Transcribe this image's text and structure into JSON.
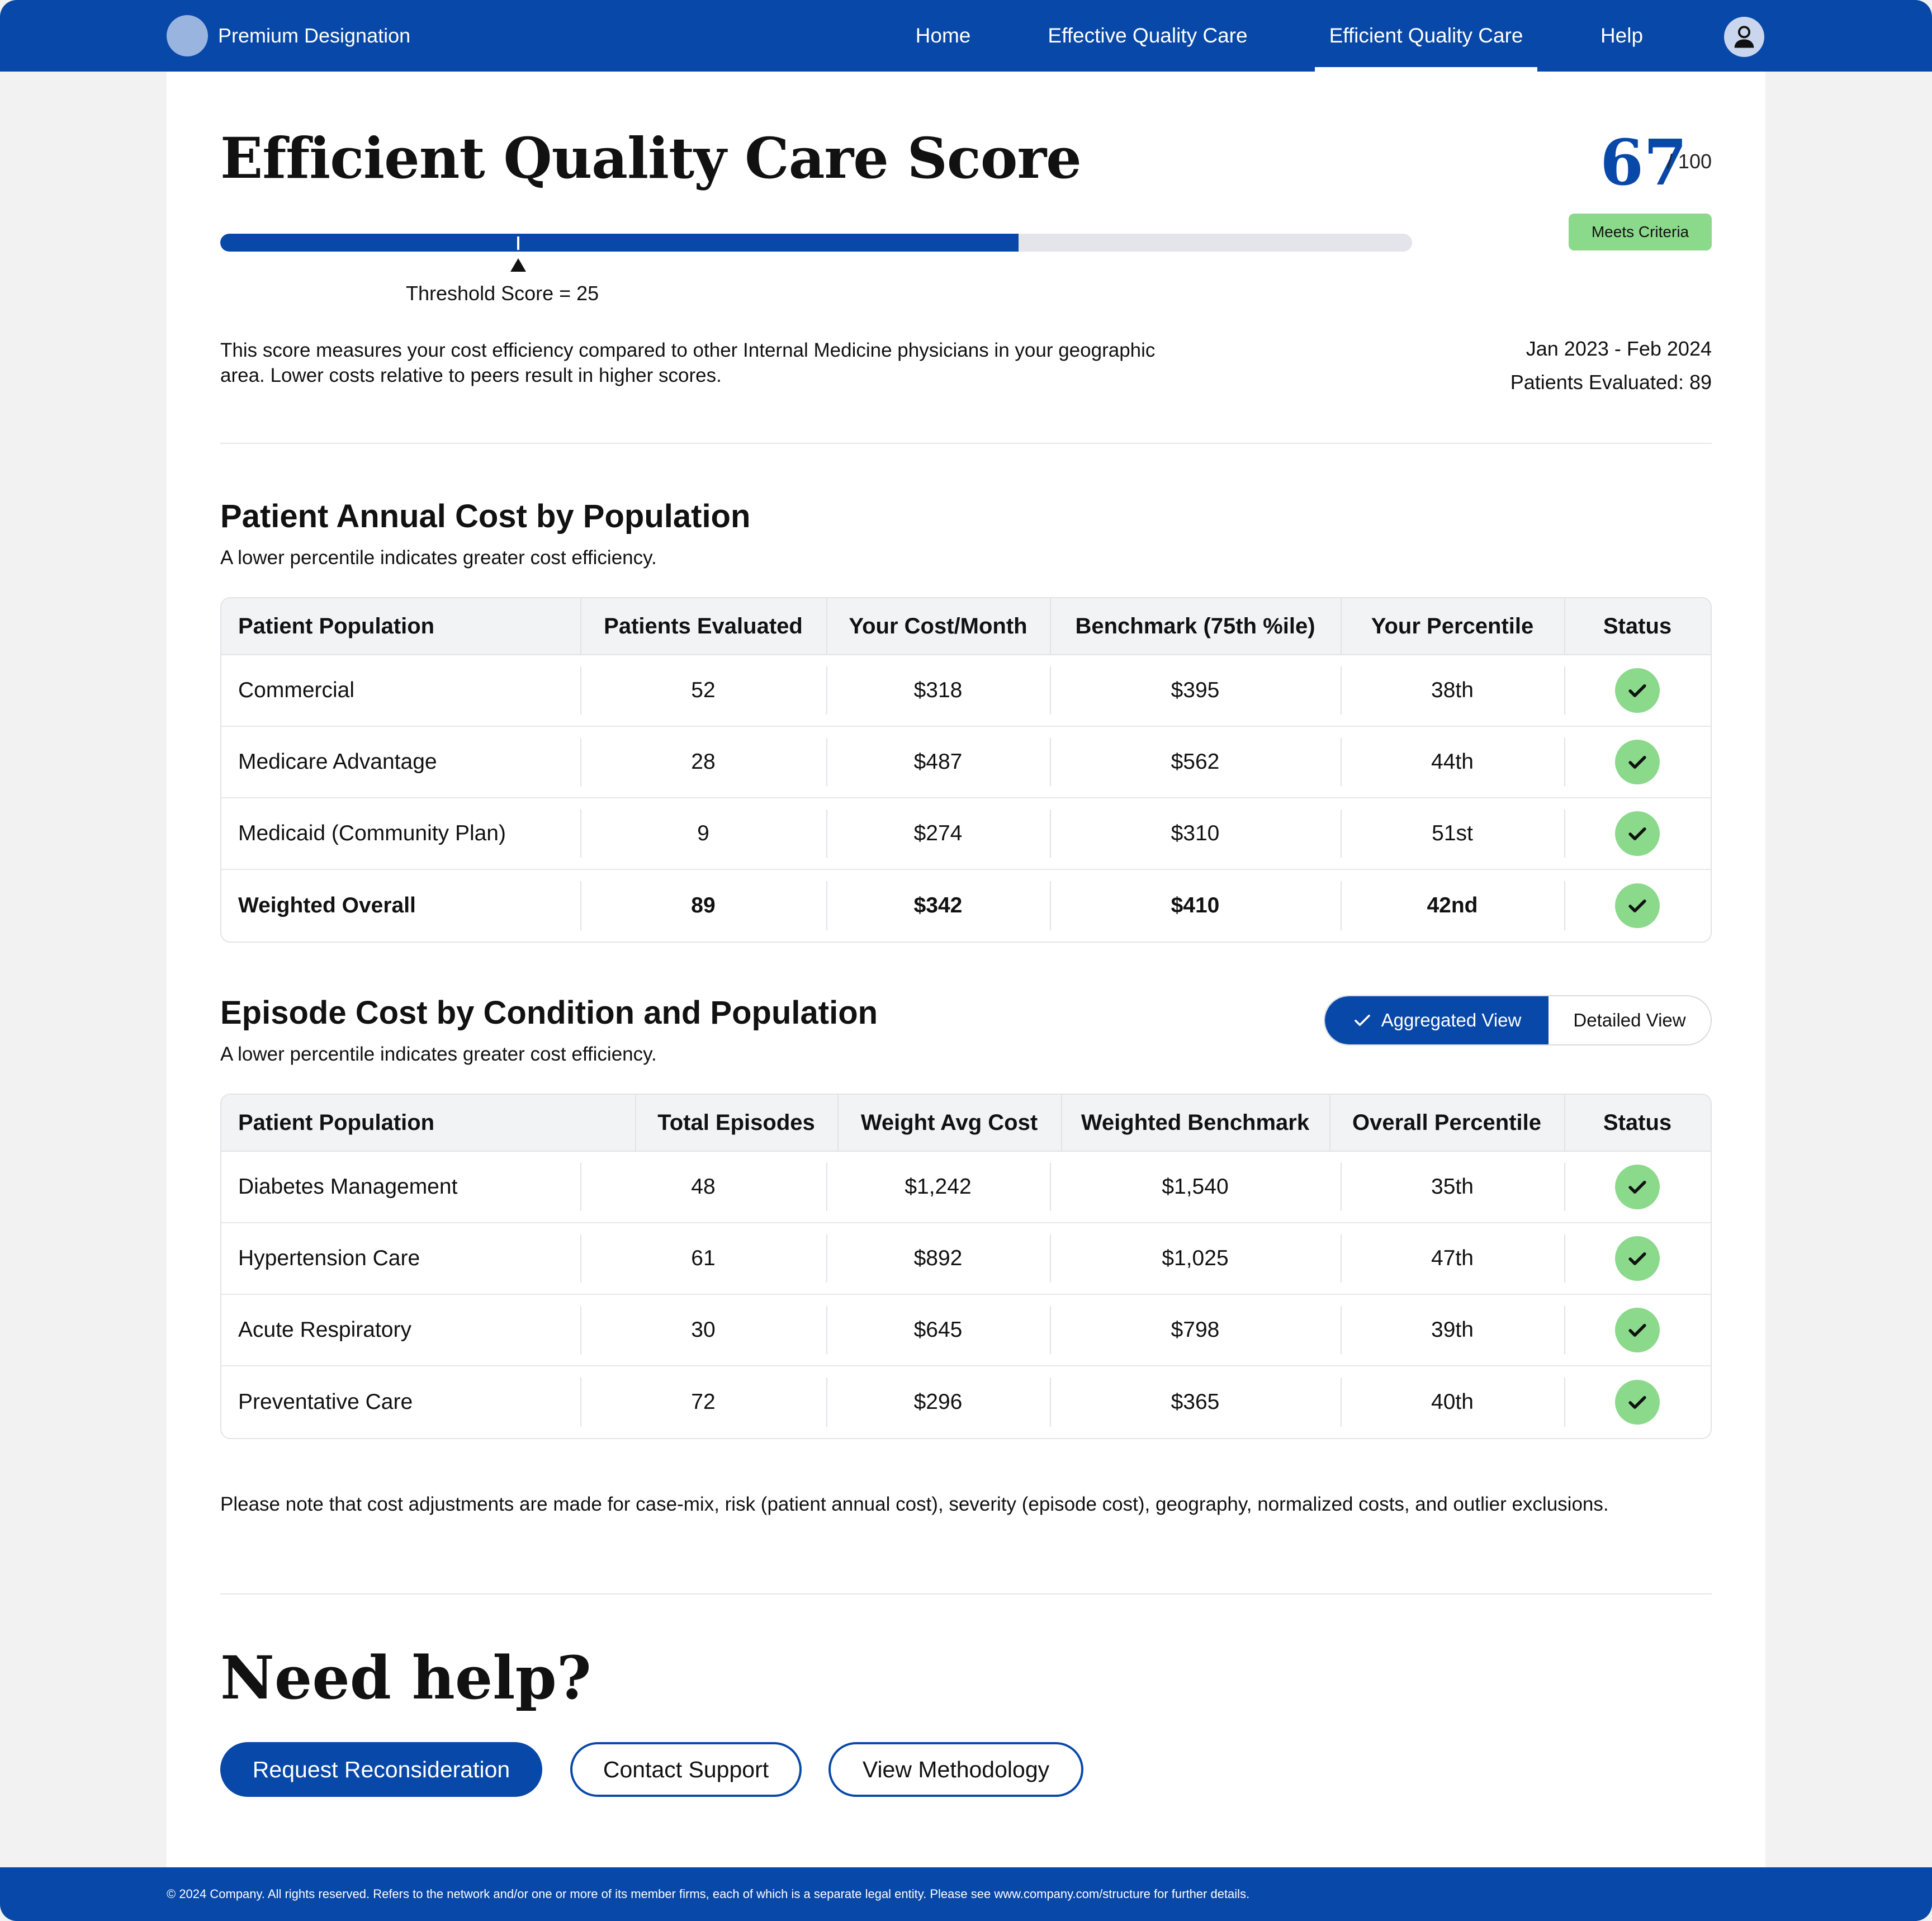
{
  "nav": {
    "brand": "Premium Designation",
    "links": [
      "Home",
      "Effective Quality Care",
      "Efficient Quality Care",
      "Help"
    ],
    "active": "Efficient Quality Care",
    "avatar_icon": "user-icon"
  },
  "header": {
    "title": "Efficient Quality Care Score",
    "score": "67",
    "score_max": "/ 100",
    "badge": "Meets Criteria",
    "progress_fraction": 0.67,
    "threshold_fraction": 0.25,
    "threshold_label": "Threshold Score = 25",
    "description": "This score measures your cost efficiency compared to other Internal Medicine physicians in your geographic area. Lower costs relative to peers result in higher scores.",
    "period": "Jan 2023 - Feb 2024",
    "patients_evaluated": "Patients Evaluated: 89"
  },
  "annual": {
    "title": "Patient Annual Cost by Population",
    "subtitle": "A lower percentile indicates greater cost efficiency.",
    "columns": [
      "Patient Population",
      "Patients Evaluated",
      "Your Cost/Month",
      "Benchmark (75th %ile)",
      "Your Percentile",
      "Status"
    ],
    "rows": [
      [
        "Commercial",
        "52",
        "$318",
        "$395",
        "38th"
      ],
      [
        "Medicare Advantage",
        "28",
        "$487",
        "$562",
        "44th"
      ],
      [
        "Medicaid (Community Plan)",
        "9",
        "$274",
        "$310",
        "51st"
      ],
      [
        "Weighted Overall",
        "89",
        "$342",
        "$410",
        "42nd"
      ]
    ]
  },
  "episode": {
    "title": "Episode Cost by Condition and Population",
    "subtitle": "A lower percentile indicates greater cost efficiency.",
    "toggle": {
      "aggregated": "Aggregated View",
      "detailed": "Detailed View"
    },
    "columns": [
      "Patient Population",
      "Total Episodes",
      "Weight Avg Cost",
      "Weighted Benchmark",
      "Overall Percentile",
      "Status"
    ],
    "rows": [
      [
        "Diabetes Management",
        "48",
        "$1,242",
        "$1,540",
        "35th"
      ],
      [
        "Hypertension Care",
        "61",
        "$892",
        "$1,025",
        "47th"
      ],
      [
        "Acute Respiratory",
        "30",
        "$645",
        "$798",
        "39th"
      ],
      [
        "Preventative Care",
        "72",
        "$296",
        "$365",
        "40th"
      ]
    ]
  },
  "note": "Please note that cost adjustments are made for case-mix, risk (patient annual cost), severity (episode cost), geography, normalized costs, and outlier exclusions.",
  "help": {
    "title": "Need help?",
    "buttons": [
      "Request Reconsideration",
      "Contact Support",
      "View Methodology"
    ]
  },
  "footer": "© 2024 Company. All rights reserved. Refers to the network and/or one or more of its member firms, each of which is a separate legal entity. Please see www.company.com/structure for further details.",
  "colors": {
    "brand": "#0848a8",
    "success": "#8bd98b",
    "track": "#e4e5ea"
  }
}
